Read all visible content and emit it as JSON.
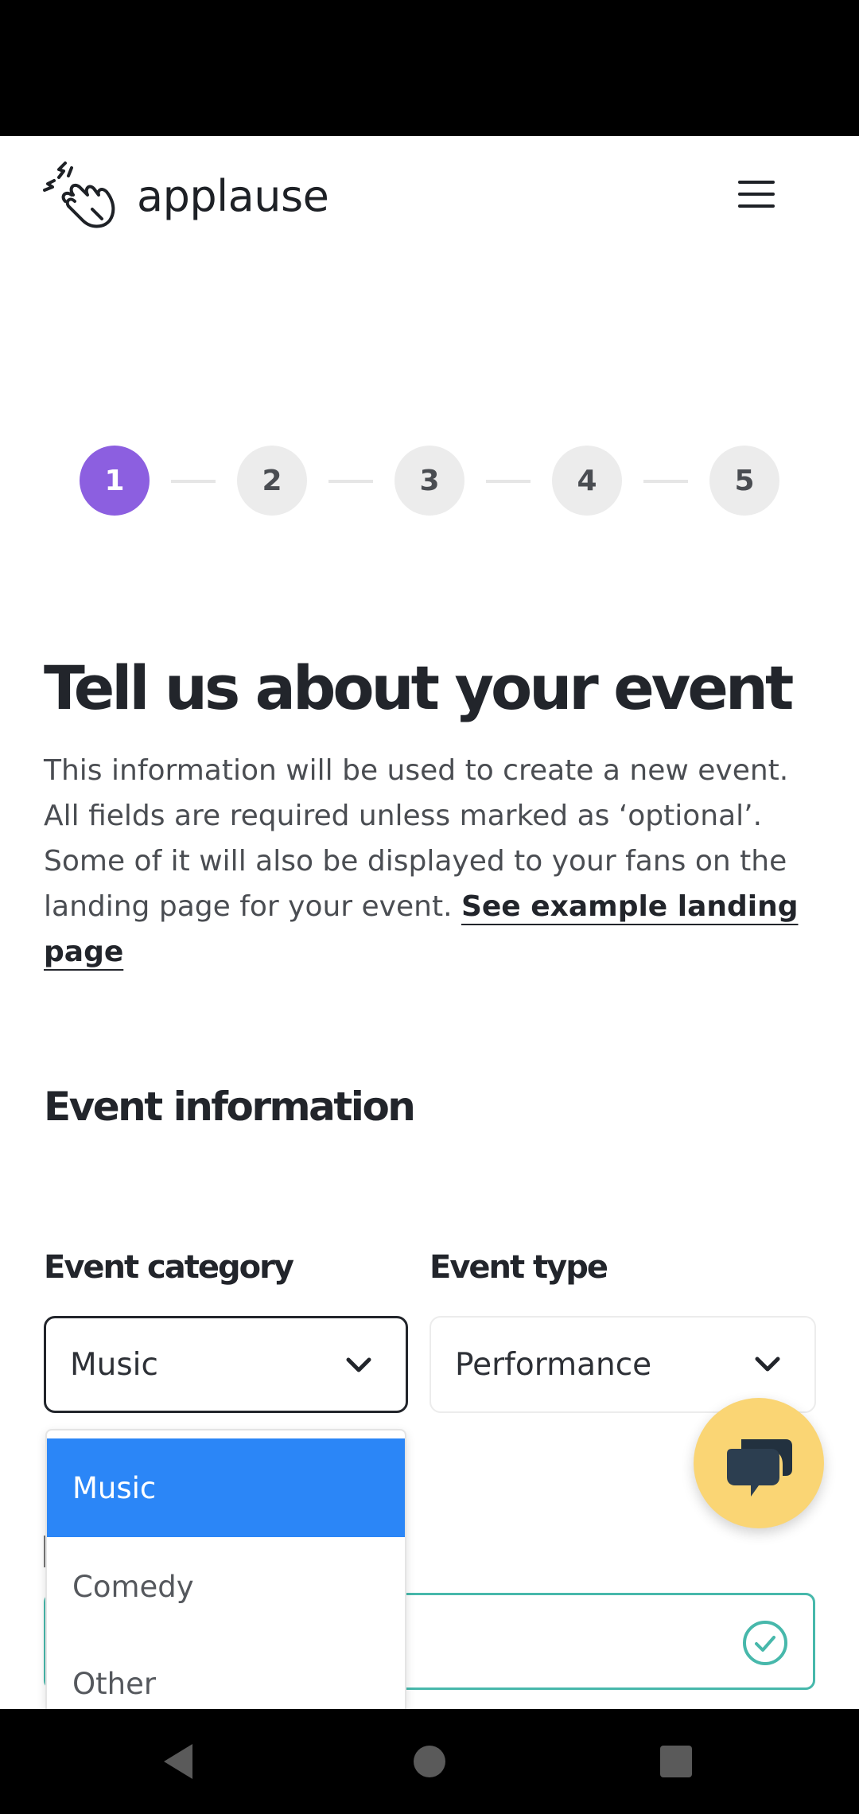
{
  "app": {
    "logo_text": "applause",
    "menu_icon": "hamburger-menu-icon"
  },
  "stepper": {
    "steps": [
      "1",
      "2",
      "3",
      "4",
      "5"
    ],
    "active_step": 1,
    "active_color": "#8c5fe0"
  },
  "page": {
    "title": "Tell us about your event",
    "intro_text": "This information will be used to create a new event. All fields are required unless marked as ‘optional’. Some of it will also be displayed to your fans on the landing page for your event. ",
    "intro_link": "See example landing page"
  },
  "form": {
    "section_title": "Event information",
    "event_category": {
      "label": "Event category",
      "value": "Music",
      "options": [
        "Music",
        "Comedy",
        "Other"
      ],
      "selected_option": "Music"
    },
    "event_type": {
      "label": "Event type",
      "value": "Performance"
    },
    "event_name": {
      "valid": true,
      "valid_color": "#47b8ab"
    }
  },
  "chat": {
    "icon": "chat-bubbles-icon",
    "color": "#fad574"
  },
  "colors": {
    "selected_option": "#2b86f7"
  }
}
